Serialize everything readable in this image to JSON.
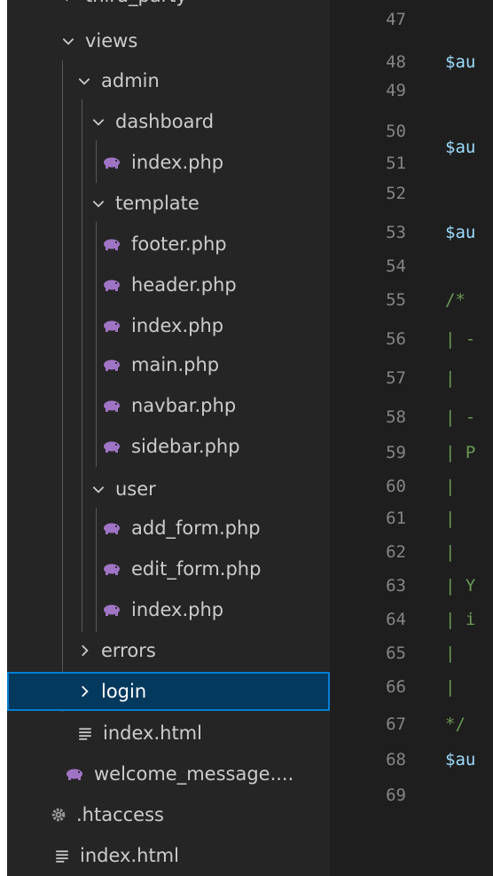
{
  "explorer": {
    "top_item": "third_party",
    "views": {
      "label": "views"
    },
    "admin": {
      "label": "admin"
    },
    "dashboard": {
      "label": "dashboard"
    },
    "dashboard_index": {
      "label": "index.php"
    },
    "template": {
      "label": "template"
    },
    "footer": {
      "label": "footer.php"
    },
    "header": {
      "label": "header.php"
    },
    "template_index": {
      "label": "index.php"
    },
    "main": {
      "label": "main.php"
    },
    "navbar": {
      "label": "navbar.php"
    },
    "sidebar": {
      "label": "sidebar.php"
    },
    "user": {
      "label": "user"
    },
    "add_form": {
      "label": "add_form.php"
    },
    "edit_form": {
      "label": "edit_form.php"
    },
    "user_index": {
      "label": "index.php"
    },
    "errors": {
      "label": "errors"
    },
    "login": {
      "label": "login"
    },
    "views_index_html": {
      "label": "index.html"
    },
    "welcome": {
      "label": "welcome_message...."
    },
    "htaccess": {
      "label": ".htaccess"
    },
    "root_index_html": {
      "label": "index.html"
    }
  },
  "editor": {
    "line_numbers": [
      "47",
      "48",
      "49",
      "50",
      "51",
      "52",
      "53",
      "54",
      "55",
      "56",
      "57",
      "58",
      "59",
      "60",
      "61",
      "62",
      "63",
      "64",
      "65",
      "66",
      "67",
      "68",
      "69"
    ],
    "code": {
      "l48": "$au",
      "l50": "$au",
      "l53": "$au",
      "l55": "/*",
      "l56": "| -",
      "l57": "|",
      "l58": "| -",
      "l59": "| P",
      "l60": "|",
      "l61": "|",
      "l62": "|",
      "l63": "| Y",
      "l64": "| i",
      "l65": "|",
      "l66": "|",
      "l67": "*/",
      "l68": "$au"
    }
  },
  "colors": {
    "sidebar_bg": "#252526",
    "editor_bg": "#1e1e1e",
    "selection_bg": "#04395e",
    "selection_border": "#007fd4",
    "php_icon": "#a074c4",
    "comment": "#6a9955",
    "variable": "#9cdcfe",
    "line_number": "#858585"
  }
}
